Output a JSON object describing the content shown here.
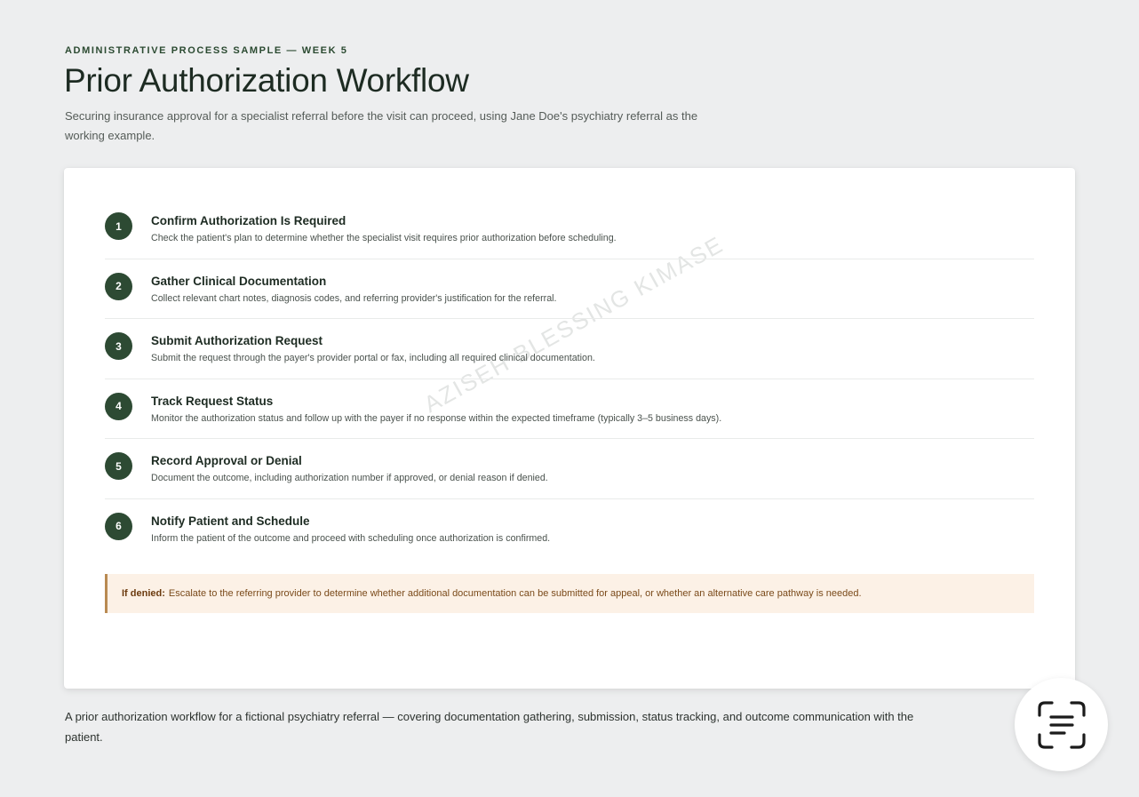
{
  "header": {
    "eyebrow": "ADMINISTRATIVE PROCESS SAMPLE — WEEK 5",
    "title": "Prior Authorization Workflow",
    "subtitle": "Securing insurance approval for a specialist referral before the visit can proceed, using Jane Doe's psychiatry referral as the working example."
  },
  "steps": [
    {
      "number": "1",
      "title": "Confirm Authorization Is Required",
      "description": "Check the patient's plan to determine whether the specialist visit requires prior authorization before scheduling."
    },
    {
      "number": "2",
      "title": "Gather Clinical Documentation",
      "description": "Collect relevant chart notes, diagnosis codes, and referring provider's justification for the referral."
    },
    {
      "number": "3",
      "title": "Submit Authorization Request",
      "description": "Submit the request through the payer's provider portal or fax, including all required clinical documentation."
    },
    {
      "number": "4",
      "title": "Track Request Status",
      "description": "Monitor the authorization status and follow up with the payer if no response within the expected timeframe (typically 3–5 business days)."
    },
    {
      "number": "5",
      "title": "Record Approval or Denial",
      "description": "Document the outcome, including authorization number if approved, or denial reason if denied."
    },
    {
      "number": "6",
      "title": "Notify Patient and Schedule",
      "description": "Inform the patient of the outcome and proceed with scheduling once authorization is confirmed."
    }
  ],
  "watermark": "AZISEH BLESSING KIMASE",
  "note": {
    "label": "If denied:",
    "text": "Escalate to the referring provider to determine whether additional documentation can be submitted for appeal, or whether an alternative care pathway is needed."
  },
  "caption": "A prior authorization workflow for a fictional psychiatry referral — covering documentation gathering, submission, status tracking, and outcome communication with the patient.",
  "fab": {
    "icon": "text-scan-icon"
  },
  "colors": {
    "accent": "#2d4a33",
    "note_background": "#fcf1e6",
    "note_border": "#b98a52",
    "page_background": "#edeeef"
  }
}
